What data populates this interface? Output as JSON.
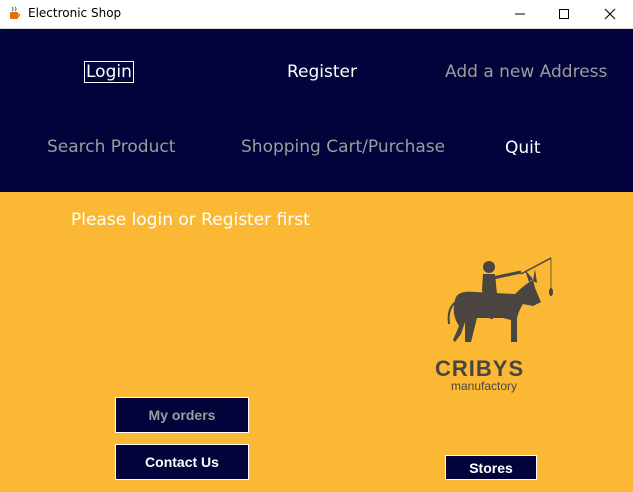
{
  "window": {
    "title": "Electronic Shop",
    "app_icon": "java-cup-icon",
    "controls": [
      "minimize-icon",
      "maximize-icon",
      "close-icon"
    ]
  },
  "nav": {
    "login": "Login",
    "register": "Register",
    "add_address": "Add a new Address",
    "search_product": "Search Product",
    "shopping_cart": "Shopping Cart/Purchase",
    "quit": "Quit"
  },
  "main": {
    "prompt": "Please login or Register first",
    "logo": {
      "name": "CRIBYS",
      "subtitle": "manufactory",
      "graphic": "rider-on-donkey-icon"
    },
    "buttons": {
      "my_orders": "My orders",
      "contact_us": "Contact Us",
      "stores": "Stores"
    }
  },
  "colors": {
    "nav_background": "#02033a",
    "content_background": "#fbb834",
    "active_text": "#ffffff",
    "disabled_text": "#9c9c9c",
    "logo_ink": "#4a4540"
  }
}
